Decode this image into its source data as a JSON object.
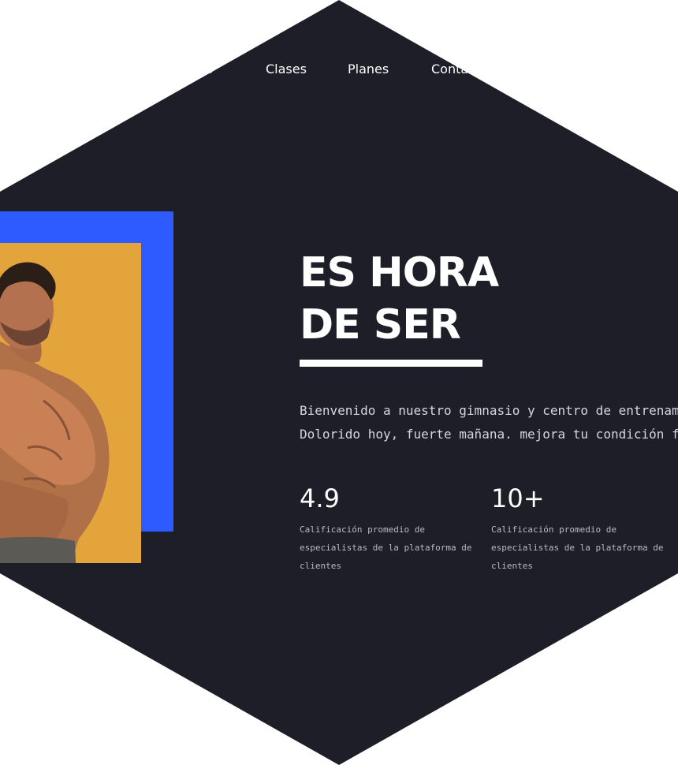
{
  "nav": {
    "items": [
      {
        "label": "Servicios"
      },
      {
        "label": "Clases"
      },
      {
        "label": "Planes"
      },
      {
        "label": "Contacto"
      }
    ]
  },
  "hero": {
    "headline_line1": "ES HORA",
    "headline_line2": "DE SER",
    "intro_line1": "Bienvenido a nuestro gimnasio y centro de entrenamiento.",
    "intro_line2": "Dolorido hoy, fuerte mañana. mejora tu condición física."
  },
  "stats": [
    {
      "value": "4.9",
      "description": "Calificación promedio de especialistas de la plataforma de clientes"
    },
    {
      "value": "10+",
      "description": "Calificación promedio de especialistas de la plataforma de clientes"
    }
  ],
  "colors": {
    "background": "#1d1e27",
    "accent_blue": "#2d5bff",
    "photo_background": "#e3a43b",
    "text": "#ffffff"
  },
  "icons": {
    "hero_photo": "muscular-man-photo"
  }
}
